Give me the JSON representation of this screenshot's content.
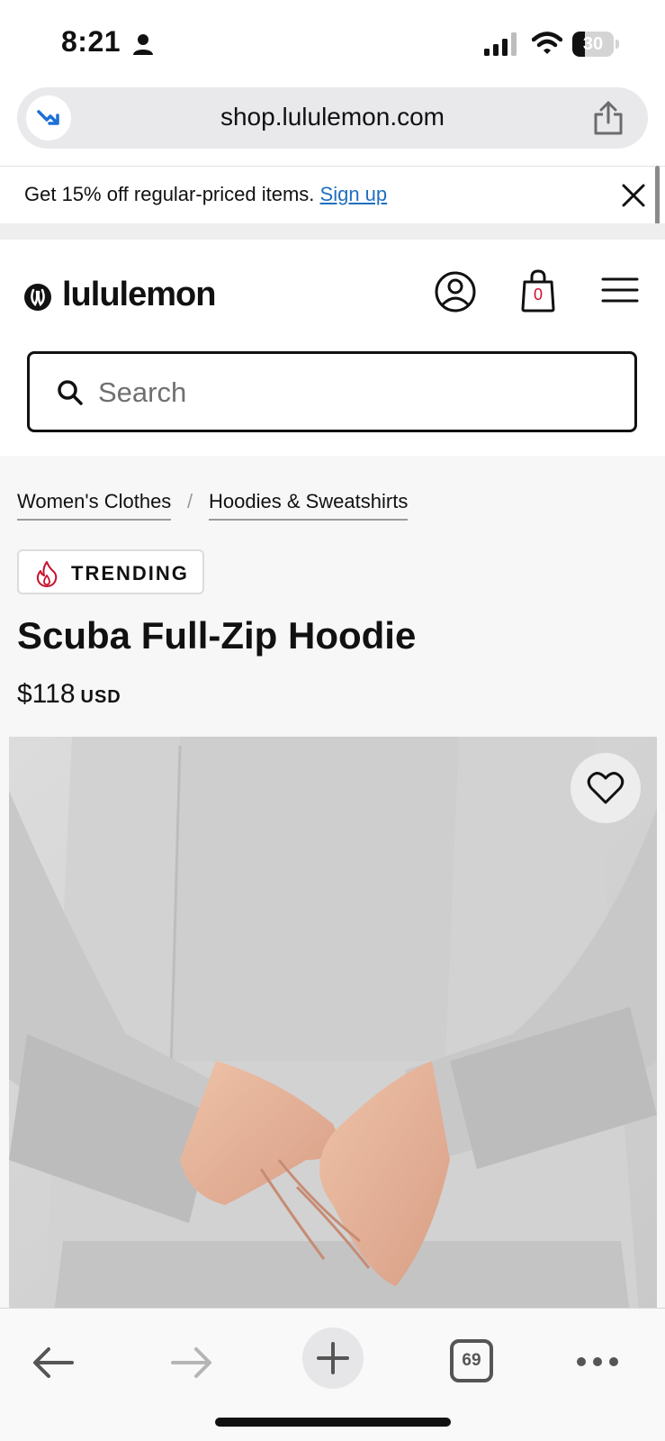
{
  "status_bar": {
    "time": "8:21",
    "battery_level": "30",
    "battery_fraction": 0.3
  },
  "browser": {
    "url": "shop.lululemon.com",
    "tab_count": "69"
  },
  "promo": {
    "text": "Get 15% off regular-priced items. ",
    "link_label": "Sign up"
  },
  "header": {
    "brand": "lululemon",
    "bag_count": "0",
    "search_placeholder": "Search"
  },
  "breadcrumb": {
    "items": [
      "Women's Clothes",
      "Hoodies & Sweatshirts"
    ],
    "separator": "/"
  },
  "product": {
    "badge": "TRENDING",
    "title": "Scuba Full-Zip Hoodie",
    "price": "$118",
    "currency": "USD"
  },
  "icons": {
    "status": [
      "person-icon",
      "signal-icon",
      "wifi-icon",
      "battery-icon"
    ],
    "browser": [
      "site-badge-icon",
      "share-icon"
    ],
    "header": [
      "logo-mark-icon",
      "account-icon",
      "bag-icon",
      "menu-icon",
      "search-icon"
    ],
    "toolbar": [
      "back-icon",
      "forward-icon",
      "plus-icon",
      "tabs-icon",
      "more-icon"
    ]
  },
  "colors": {
    "link": "#1f6fbf",
    "brand_red": "#c8102e",
    "text": "#111111"
  }
}
